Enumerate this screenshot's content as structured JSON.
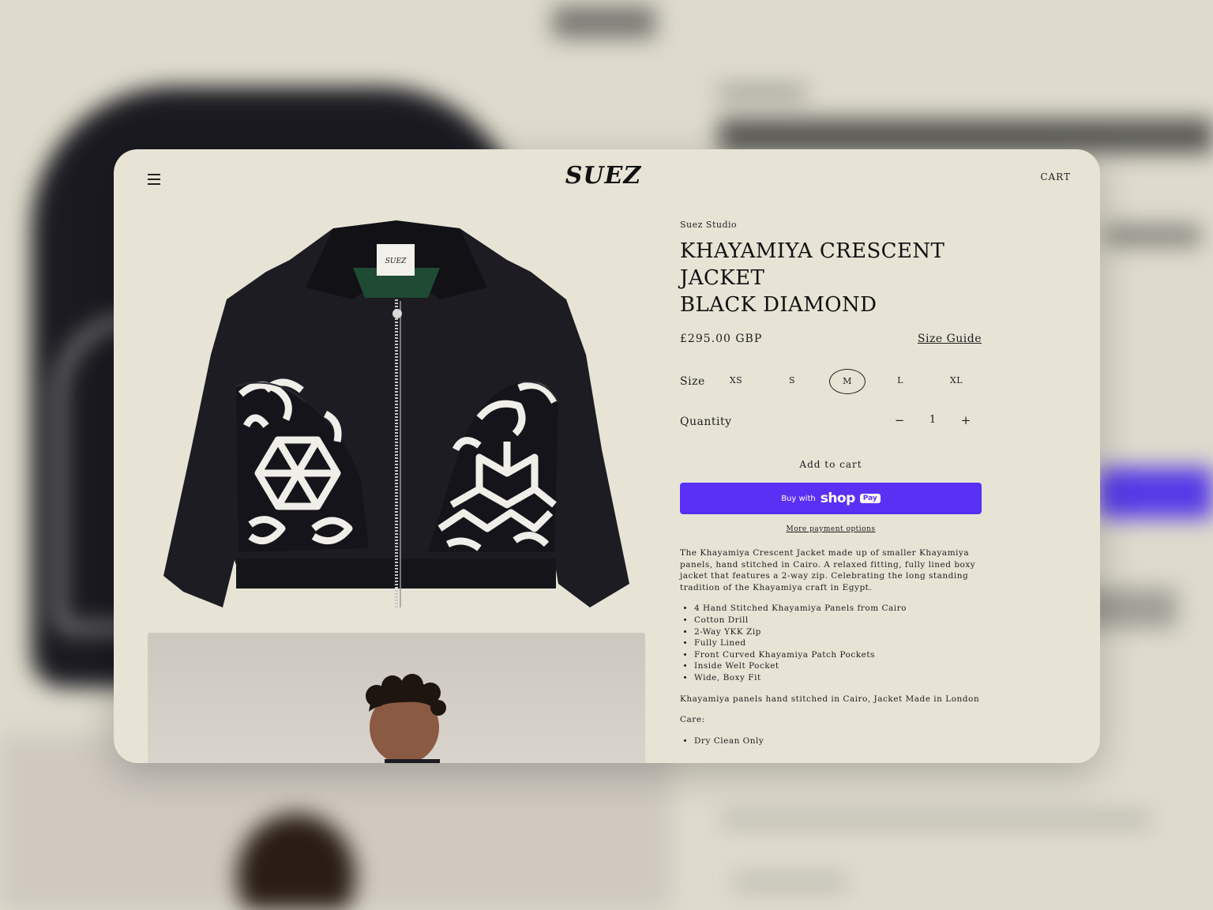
{
  "header": {
    "brand": "SUEZ",
    "cart_label": "CART"
  },
  "product": {
    "vendor": "Suez Studio",
    "title_line1": "KHAYAMIYA CRESCENT JACKET",
    "title_line2": "BLACK DIAMOND",
    "price": "£295.00 GBP",
    "size_guide_label": "Size Guide",
    "size_label": "Size",
    "sizes": [
      "XS",
      "S",
      "M",
      "L",
      "XL"
    ],
    "selected_size": "M",
    "quantity_label": "Quantity",
    "quantity": "1",
    "decrease_symbol": "−",
    "increase_symbol": "+",
    "add_to_cart_label": "Add to cart",
    "shop_pay": {
      "prefix": "Buy with",
      "brand": "shop",
      "badge": "Pay"
    },
    "more_payment_label": "More payment options",
    "description": "The Khayamiya Crescent Jacket made up of smaller Khayamiya panels, hand stitched in Cairo. A relaxed fitting, fully lined boxy jacket that features a 2-way zip. Celebrating the long standing tradition of the Khayamiya craft in Egypt.",
    "features": [
      "4 Hand Stitched Khayamiya Panels from Cairo",
      "Cotton Drill",
      "2-Way YKK Zip",
      "Fully Lined",
      "Front Curved Khayamiya Patch Pockets",
      "Inside Welt Pocket",
      "Wide, Boxy Fit"
    ],
    "origin_note": "Khayamiya panels hand stitched in Cairo, Jacket Made in London",
    "care_label": "Care:",
    "care": [
      "Dry Clean Only"
    ],
    "jacket_label_text": "SUEZ"
  },
  "colors": {
    "background": "#e7e4d6",
    "shop_pay": "#5a31f4",
    "jacket": "#1c1c22",
    "collar_lining": "#1f4a33"
  }
}
